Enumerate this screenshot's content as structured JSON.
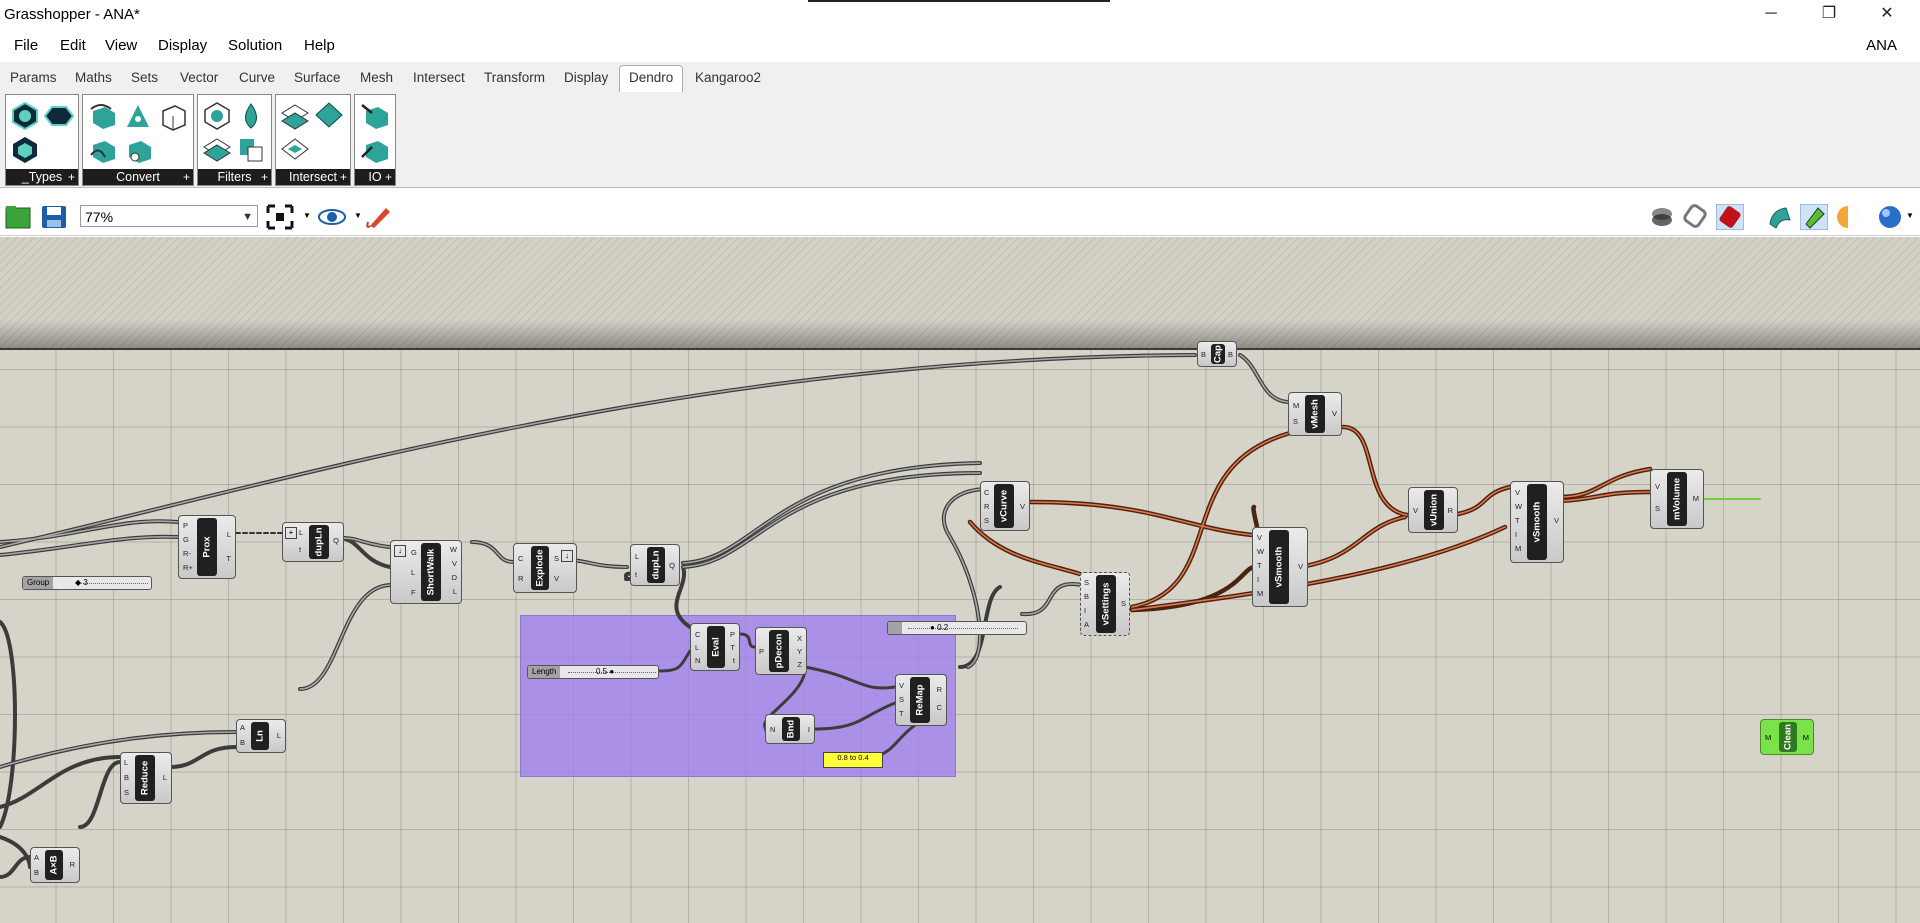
{
  "window": {
    "title": "Grasshopper - ANA*",
    "minimize": "─",
    "restore": "❐",
    "close": "✕"
  },
  "menu": [
    "File",
    "Edit",
    "View",
    "Display",
    "Solution",
    "Help"
  ],
  "user": "ANA",
  "tabs": [
    "Params",
    "Maths",
    "Sets",
    "Vector",
    "Curve",
    "Surface",
    "Mesh",
    "Intersect",
    "Transform",
    "Display",
    "Dendro",
    "Kangaroo2"
  ],
  "active_tab": "Dendro",
  "ribbon_groups": [
    "_Types",
    "Convert",
    "Filters",
    "Intersect",
    "IO"
  ],
  "toolbar": {
    "zoom": "77%"
  },
  "components": {
    "cap": {
      "name": "Cap",
      "in": [
        "B"
      ],
      "out": [
        "B"
      ]
    },
    "vmesh": {
      "name": "vMesh",
      "in": [
        "M",
        "S"
      ],
      "out": [
        "V"
      ]
    },
    "prox": {
      "name": "Prox",
      "in": [
        "P",
        "G",
        "R-",
        "R+"
      ],
      "out": [
        "L",
        "T"
      ]
    },
    "dupln1": {
      "name": "dupLn",
      "in": [
        "L",
        "t"
      ],
      "out": [
        "Q"
      ]
    },
    "shortwalk": {
      "name": "ShortWalk",
      "in": [
        "G",
        "L",
        "F"
      ],
      "out": [
        "W",
        "V",
        "D",
        "L"
      ]
    },
    "explode": {
      "name": "Explode",
      "in": [
        "C",
        "R"
      ],
      "out": [
        "S",
        "V"
      ]
    },
    "dupln2": {
      "name": "dupLn",
      "in": [
        "L",
        "t"
      ],
      "out": [
        "Q"
      ]
    },
    "vcurve": {
      "name": "vCurve",
      "in": [
        "C",
        "R",
        "S"
      ],
      "out": [
        "V"
      ]
    },
    "vsettings": {
      "name": "vSettings",
      "in": [
        "S",
        "B",
        "I",
        "A"
      ],
      "out": [
        "S"
      ]
    },
    "vsmooth1": {
      "name": "vSmooth",
      "in": [
        "V",
        "W",
        "T",
        "I",
        "M"
      ],
      "out": [
        "V"
      ]
    },
    "vunion": {
      "name": "vUnion",
      "in": [
        "V"
      ],
      "out": [
        "R"
      ]
    },
    "vsmooth2": {
      "name": "vSmooth",
      "in": [
        "V",
        "W",
        "T",
        "I",
        "M"
      ],
      "out": [
        "V"
      ]
    },
    "mvolume": {
      "name": "mVolume",
      "in": [
        "V",
        "S"
      ],
      "out": [
        "M"
      ]
    },
    "clean": {
      "name": "Clean",
      "in": [
        "M"
      ],
      "out": [
        "M"
      ]
    },
    "eval": {
      "name": "Eval",
      "in": [
        "C",
        "L",
        "N"
      ],
      "out": [
        "P",
        "T",
        "t"
      ]
    },
    "pdecon": {
      "name": "pDecon",
      "in": [
        "P"
      ],
      "out": [
        "X",
        "Y",
        "Z"
      ]
    },
    "bnd": {
      "name": "Bnd",
      "in": [
        "N"
      ],
      "out": [
        "I"
      ]
    },
    "remap": {
      "name": "ReMap",
      "in": [
        "V",
        "S",
        "T"
      ],
      "out": [
        "R",
        "C"
      ]
    },
    "ln": {
      "name": "Ln",
      "in": [
        "A",
        "B"
      ],
      "out": [
        "L"
      ]
    },
    "reduce": {
      "name": "Reduce",
      "in": [
        "L",
        "B",
        "S"
      ],
      "out": [
        "L"
      ]
    },
    "axb": {
      "name": "A×B",
      "in": [
        "A",
        "B"
      ],
      "out": [
        "R"
      ]
    }
  },
  "sliders": {
    "group": {
      "label": "Group",
      "value": "3"
    },
    "length": {
      "label": "Length",
      "value": "0.5"
    },
    "settings": {
      "label": "",
      "value": "0.2"
    }
  },
  "panel": {
    "text": "0.8 to 0.4"
  }
}
